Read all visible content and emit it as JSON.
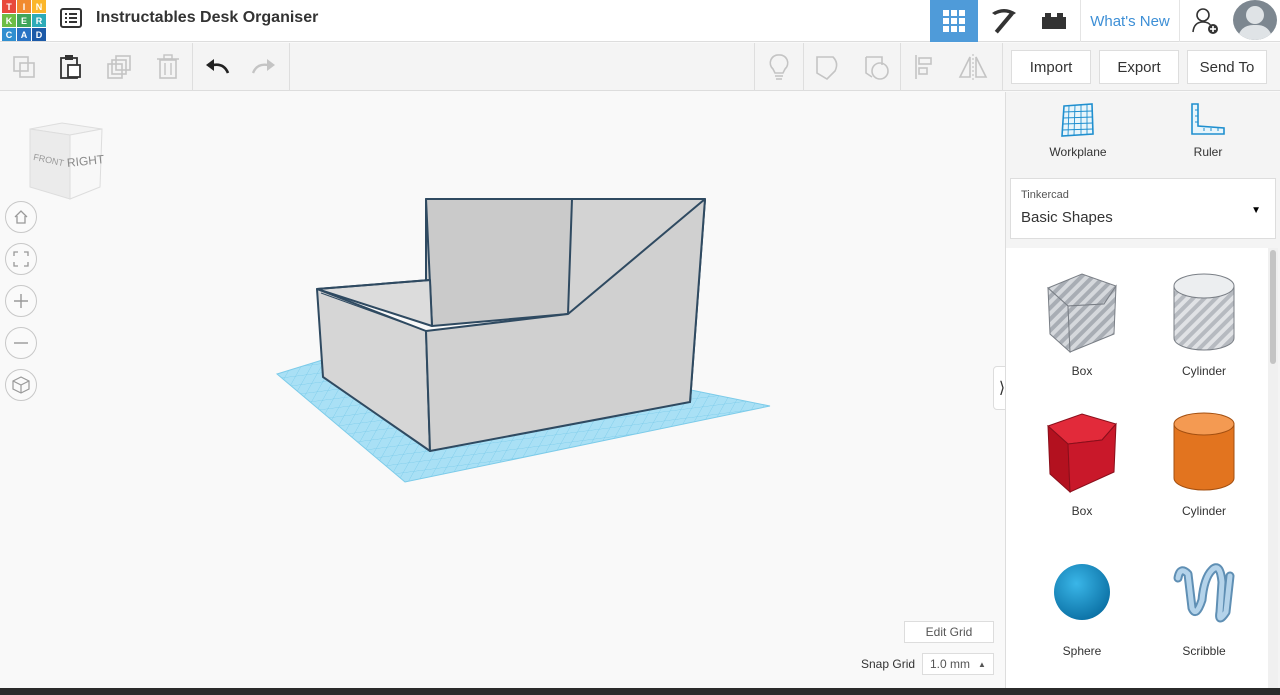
{
  "app": {
    "logo_letters": [
      "T",
      "I",
      "N",
      "K",
      "E",
      "R",
      "C",
      "A",
      "D"
    ],
    "project_title": "Instructables Desk Organiser"
  },
  "header": {
    "whats_new_label": "What's New",
    "accent_color": "#4f9bd9"
  },
  "toolbar": {
    "icons": [
      "copy-icon",
      "paste-icon",
      "duplicate-icon",
      "delete-icon",
      "undo-icon",
      "redo-icon",
      "lightbulb-icon",
      "solid-icon",
      "hole-icon",
      "align-icon",
      "mirror-icon"
    ],
    "import_label": "Import",
    "export_label": "Export",
    "send_to_label": "Send To"
  },
  "viewport": {
    "view_cube_front": "FRONT",
    "view_cube_right": "RIGHT",
    "nav_icons": [
      "home-icon",
      "fit-icon",
      "zoom-in-icon",
      "zoom-out-icon",
      "ortho-icon"
    ],
    "edit_grid_label": "Edit Grid",
    "snap_grid_label": "Snap Grid",
    "snap_grid_value": "1.0 mm"
  },
  "panel": {
    "workplane_label": "Workplane",
    "ruler_label": "Ruler",
    "library_source": "Tinkercad",
    "library_name": "Basic Shapes",
    "shapes": [
      {
        "label": "Box",
        "color": "#b9bec4"
      },
      {
        "label": "Cylinder",
        "color": "#c9ccd0"
      },
      {
        "label": "Box",
        "color": "#d0182a"
      },
      {
        "label": "Cylinder",
        "color": "#e87a24"
      },
      {
        "label": "Sphere",
        "color": "#1591c9"
      },
      {
        "label": "Scribble",
        "color": "#8fb7d6"
      }
    ]
  }
}
